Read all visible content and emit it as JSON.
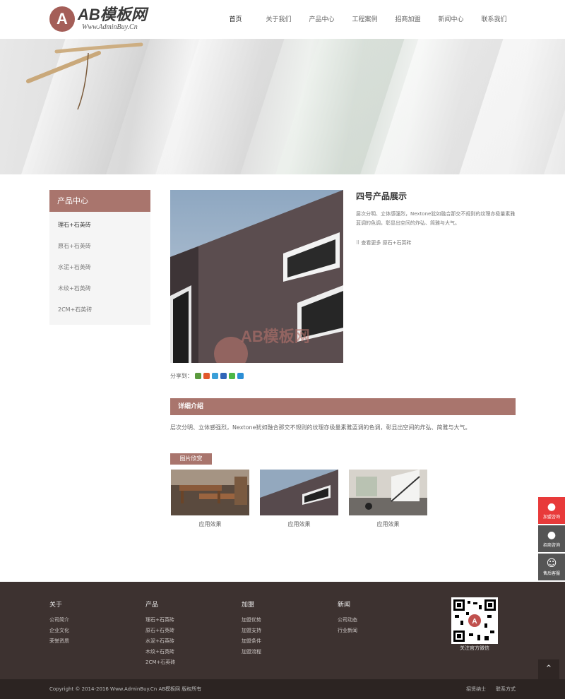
{
  "header": {
    "logo_mark": "A",
    "logo_text": "AB模板网",
    "logo_sub": "Www.AdminBuy.Cn",
    "nav": [
      "首页",
      "关于我们",
      "产品中心",
      "工程案例",
      "招商加盟",
      "新闻中心",
      "联系我们"
    ]
  },
  "sidebar": {
    "title": "产品中心",
    "items": [
      "理石+石英砖",
      "原石+石英砖",
      "水泥+石英砖",
      "木纹+石英砖",
      "2CM+石英砖"
    ]
  },
  "product": {
    "title": "四号产品展示",
    "desc": "层次分明、立体感强烈，Nextone犹如融合那交不规则的纹理亦极量素雅蓝调的色调，彰显出空间的炸弘、简雅与大气。",
    "more": "查看更多 原石+石英砖",
    "share_label": "分享到："
  },
  "detail": {
    "title": "详细介绍",
    "text": "层次分明、立体感强烈，Nextone犹如融合那交不规则的纹理亦极量素雅蓝调的色调，彰显出空间的炸弘、简雅与大气。"
  },
  "gallery": {
    "tag": "图片欣赏",
    "captions": [
      "应用效果",
      "应用效果",
      "应用效果"
    ]
  },
  "float_bar": {
    "items": [
      "加盟咨询",
      "招商咨询",
      "售后客服"
    ]
  },
  "footer": {
    "cols": [
      {
        "title": "关于",
        "items": [
          "公司简介",
          "企业文化",
          "荣誉资质"
        ]
      },
      {
        "title": "产品",
        "items": [
          "理石+石英砖",
          "原石+石英砖",
          "水泥+石英砖",
          "木纹+石英砖",
          "2CM+石英砖"
        ]
      },
      {
        "title": "加盟",
        "items": [
          "加盟优势",
          "加盟支持",
          "加盟条件",
          "加盟流程"
        ]
      },
      {
        "title": "新闻",
        "items": [
          "公司动态",
          "行业新闻"
        ]
      }
    ],
    "qr_caption": "关注官方微信",
    "totop": "⌃"
  },
  "copyright": {
    "text": "Copyright © 2014-2016 Www.AdminBuy.Cn AB模板网 版权所有",
    "links": [
      "招贤纳士",
      "联系方式"
    ]
  },
  "colors": {
    "accent": "#a9756d",
    "footer": "#3d3230",
    "float_red": "#e83a3a",
    "float_dark": "#555555"
  }
}
